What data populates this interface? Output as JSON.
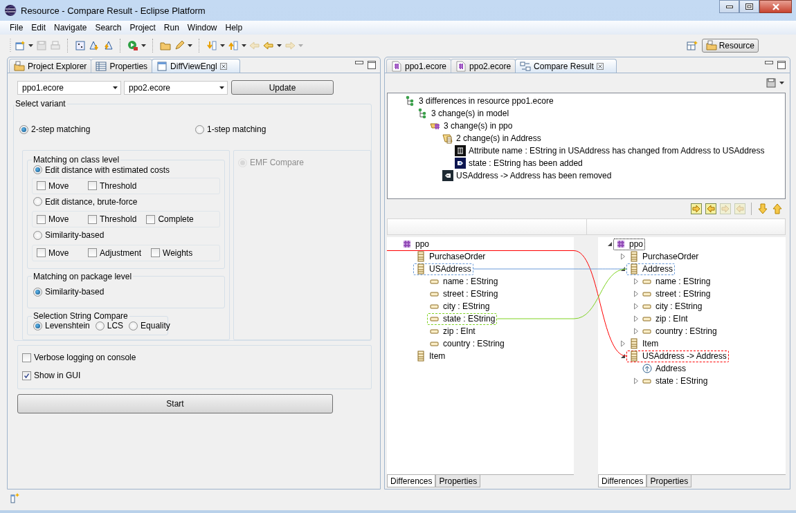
{
  "window": {
    "title": "Resource - Compare Result - Eclipse Platform"
  },
  "menu": [
    "File",
    "Edit",
    "Navigate",
    "Search",
    "Project",
    "Run",
    "Window",
    "Help"
  ],
  "toolbar": [
    {
      "kind": "new",
      "disabled": false,
      "dropdown": true
    },
    {
      "kind": "save",
      "disabled": true
    },
    {
      "kind": "print",
      "disabled": true
    },
    {
      "kind": "separator"
    },
    {
      "kind": "grid",
      "disabled": false
    },
    {
      "kind": "tri-down",
      "disabled": false
    },
    {
      "kind": "tri-up",
      "disabled": false
    },
    {
      "kind": "separator"
    },
    {
      "kind": "run",
      "disabled": false,
      "dropdown": true
    },
    {
      "kind": "separator"
    },
    {
      "kind": "folder",
      "disabled": false
    },
    {
      "kind": "pencil",
      "disabled": false,
      "dropdown": true
    },
    {
      "kind": "separator"
    },
    {
      "kind": "next",
      "disabled": false,
      "dropdown": true
    },
    {
      "kind": "prev",
      "disabled": false,
      "dropdown": true
    },
    {
      "kind": "back",
      "disabled": true
    },
    {
      "kind": "back",
      "disabled": false,
      "dropdown": true
    },
    {
      "kind": "forward",
      "disabled": true,
      "dropdown": true
    }
  ],
  "perspective": {
    "label": "Resource",
    "selected": true
  },
  "left_view": {
    "tabs": [
      {
        "kind": "explorer",
        "label": "Project Explorer",
        "selected": false,
        "closable": false
      },
      {
        "kind": "table",
        "label": "Properties",
        "selected": false,
        "closable": false
      },
      {
        "kind": "view",
        "label": "DiffViewEngl",
        "selected": true,
        "closable": true
      }
    ],
    "model_1": "ppo1.ecore",
    "model_2": "ppo2.ecore",
    "update_button": "Update",
    "variant_group": {
      "title": "Select variant",
      "options": [
        {
          "label": "2-step matching",
          "selected": true
        },
        {
          "label": "1-step matching",
          "selected": false
        }
      ]
    },
    "class_level": {
      "title": "Matching on class level",
      "methods": [
        {
          "label": "Edit distance with estimated costs",
          "selected": true,
          "options": [
            {
              "label": "Move",
              "checked": false
            },
            {
              "label": "Threshold",
              "checked": false
            }
          ]
        },
        {
          "label": "Edit distance, brute-force",
          "selected": false,
          "options": [
            {
              "label": "Move",
              "checked": false
            },
            {
              "label": "Threshold",
              "checked": false
            },
            {
              "label": "Complete",
              "checked": false
            }
          ]
        },
        {
          "label": "Similarity-based",
          "selected": false,
          "options": [
            {
              "label": "Move",
              "checked": false
            },
            {
              "label": "Adjustment",
              "checked": false
            },
            {
              "label": "Weights",
              "checked": false
            }
          ]
        }
      ]
    },
    "package_level": {
      "title": "Matching on package level",
      "options": [
        {
          "label": "Similarity-based",
          "selected": true
        }
      ]
    },
    "string_compare": {
      "title": "Selection String Compare",
      "options": [
        {
          "label": "Levenshtein",
          "selected": true
        },
        {
          "label": "LCS",
          "selected": false
        },
        {
          "label": "Equality",
          "selected": false
        }
      ]
    },
    "emf_compare": {
      "label": "EMF Compare",
      "selected": true,
      "disabled": true
    },
    "settings": [
      {
        "label": "Verbose logging on console",
        "checked": false
      },
      {
        "label": "Show in GUI",
        "checked": true
      }
    ],
    "start_button": "Start"
  },
  "right_view": {
    "tabs": [
      {
        "kind": "ecore",
        "label": "ppo1.ecore",
        "selected": false,
        "closable": false
      },
      {
        "kind": "ecore",
        "label": "ppo2.ecore",
        "selected": false,
        "closable": false
      },
      {
        "kind": "compare",
        "label": "Compare Result",
        "selected": true,
        "closable": true
      }
    ],
    "diff_tree": [
      {
        "kind": "resource",
        "label": "3 differences in resource ppo1.ecore",
        "children": [
          {
            "kind": "resource",
            "label": "3 change(s) in model",
            "children": [
              {
                "kind": "package-change",
                "label": "3 change(s) in ppo",
                "children": [
                  {
                    "kind": "class-change",
                    "label": "2 change(s) in Address",
                    "children": [
                      {
                        "kind": "change",
                        "label": "Attribute name : EString in USAddress has changed from Address to USAddress"
                      },
                      {
                        "kind": "add",
                        "label": "state : EString has been added"
                      }
                    ]
                  },
                  {
                    "kind": "remove",
                    "label": "USAddress -> Address has been removed"
                  }
                ]
              }
            ]
          }
        ]
      }
    ],
    "nav_buttons": [
      {
        "kind": "copy-right",
        "disabled": false
      },
      {
        "kind": "copy-left",
        "disabled": false
      },
      {
        "kind": "copy-right",
        "disabled": true
      },
      {
        "kind": "copy-left",
        "disabled": true
      },
      {
        "kind": "separator"
      },
      {
        "kind": "down",
        "disabled": false
      },
      {
        "kind": "up",
        "disabled": false
      }
    ],
    "left_tree": [
      {
        "kind": "package",
        "label": "ppo",
        "color": "#ff0000",
        "children": [
          {
            "kind": "class",
            "label": "PurchaseOrder"
          },
          {
            "kind": "class",
            "label": "USAddress",
            "color": "#6a9bd8",
            "children": [
              {
                "kind": "attribute",
                "label": "name : EString"
              },
              {
                "kind": "attribute",
                "label": "street : EString"
              },
              {
                "kind": "attribute",
                "label": "city : EString"
              },
              {
                "kind": "attribute",
                "label": "state : EString",
                "color": "#7ed321"
              },
              {
                "kind": "attribute",
                "label": "zip : EInt"
              },
              {
                "kind": "attribute",
                "label": "country : EString"
              }
            ]
          },
          {
            "kind": "class",
            "label": "Item"
          }
        ]
      }
    ],
    "right_tree": [
      {
        "kind": "package",
        "label": "ppo",
        "expanded": true,
        "focused": true,
        "children": [
          {
            "kind": "class",
            "label": "PurchaseOrder",
            "expanded": false
          },
          {
            "kind": "class",
            "label": "Address",
            "expanded": true,
            "color": "#6a9bd8",
            "children": [
              {
                "kind": "attribute",
                "label": "name : EString",
                "expanded": false
              },
              {
                "kind": "attribute",
                "label": "street : EString",
                "expanded": false
              },
              {
                "kind": "attribute",
                "label": "city : EString",
                "expanded": false
              },
              {
                "kind": "attribute",
                "label": "zip : EInt",
                "expanded": false
              },
              {
                "kind": "attribute",
                "label": "country : EString",
                "expanded": false
              }
            ]
          },
          {
            "kind": "class",
            "label": "Item",
            "expanded": false
          },
          {
            "kind": "class",
            "label": "USAddress -> Address",
            "expanded": true,
            "color": "#ff0000",
            "children": [
              {
                "kind": "operation",
                "label": "Address"
              },
              {
                "kind": "attribute",
                "label": "state : EString",
                "expanded": false
              }
            ]
          }
        ]
      }
    ],
    "left_tabs": [
      {
        "label": "Differences",
        "selected": true
      },
      {
        "label": "Properties",
        "selected": false
      }
    ],
    "right_tabs": [
      {
        "label": "Differences",
        "selected": true
      },
      {
        "label": "Properties",
        "selected": false
      }
    ]
  }
}
